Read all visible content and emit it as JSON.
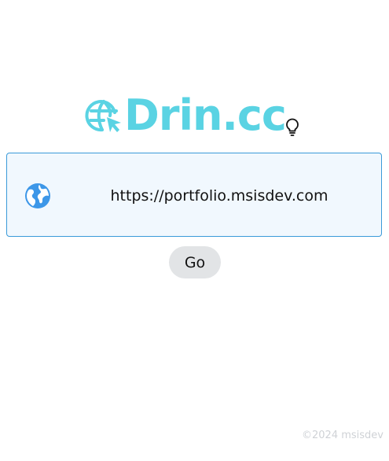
{
  "brand": {
    "name": "Drin.cc",
    "color": "#5ad3e3",
    "logo_icon": "globe-cursor-icon"
  },
  "theme_toggle": {
    "icon": "lightbulb-icon"
  },
  "url_box": {
    "icon": "globe-icon",
    "value": "https://portfolio.msisdev.com",
    "border_color": "#3a9ad9",
    "background": "#f1f8fe"
  },
  "actions": {
    "go_label": "Go"
  },
  "footer": {
    "text": "©2024 msisdev"
  }
}
